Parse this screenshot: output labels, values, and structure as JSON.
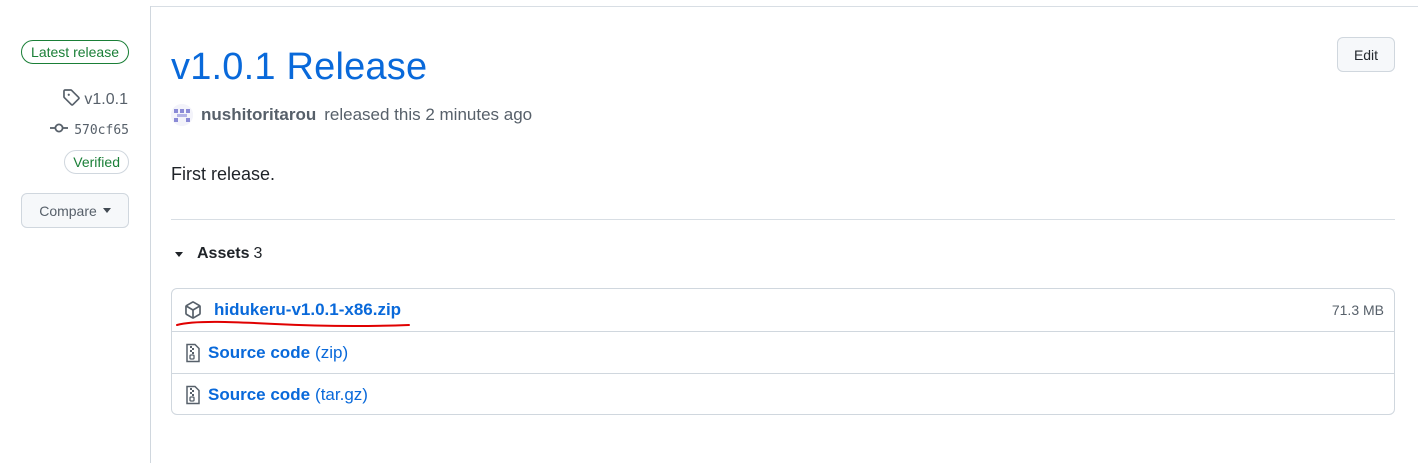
{
  "sidebar": {
    "latest_badge": "Latest release",
    "tag": "v1.0.1",
    "commit": "570cf65",
    "verified": "Verified",
    "compare_label": "Compare"
  },
  "release": {
    "title": "v1.0.1 Release",
    "edit_label": "Edit",
    "author": "nushitoritarou",
    "released_text": "released this 2 minutes ago",
    "body": "First release."
  },
  "assets": {
    "title": "Assets",
    "count": "3",
    "items": [
      {
        "name": "hidukeru-v1.0.1-x86.zip",
        "suffix": "",
        "size": "71.3 MB",
        "icon": "package-icon"
      },
      {
        "name": "Source code",
        "suffix": "(zip)",
        "size": "",
        "icon": "file-zip-icon"
      },
      {
        "name": "Source code",
        "suffix": "(tar.gz)",
        "size": "",
        "icon": "file-zip-icon"
      }
    ]
  },
  "colors": {
    "link": "#0969da",
    "success": "#1a7f37",
    "annotation": "#e00000"
  }
}
